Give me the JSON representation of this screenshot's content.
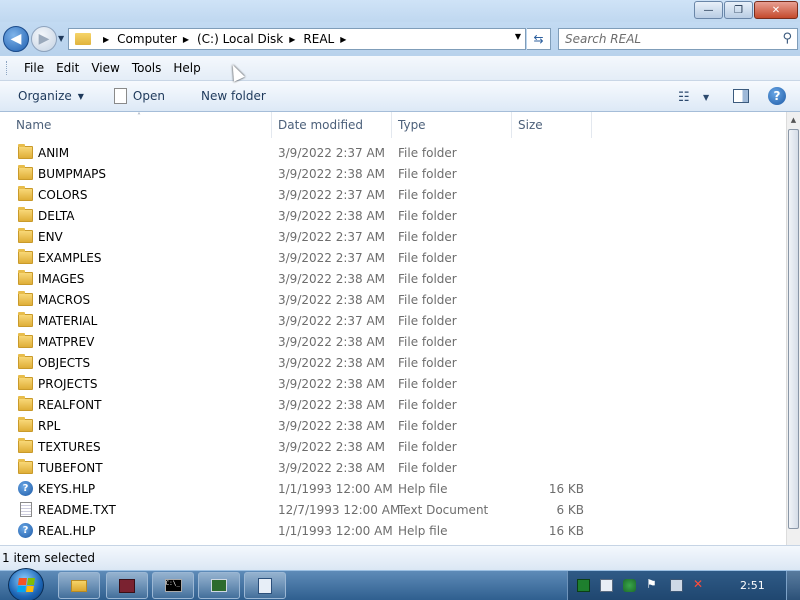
{
  "window": {
    "controls": {
      "minimize": "—",
      "maximize": "❐",
      "close": "✕"
    }
  },
  "address_bar": {
    "breadcrumbs": [
      "Computer",
      "(C:) Local Disk",
      "REAL"
    ],
    "search_placeholder": "Search REAL"
  },
  "menu": [
    "File",
    "Edit",
    "View",
    "Tools",
    "Help"
  ],
  "commands": {
    "organize": "Organize",
    "open": "Open",
    "new_folder": "New folder"
  },
  "columns": [
    "Name",
    "Date modified",
    "Type",
    "Size"
  ],
  "files": [
    {
      "icon": "folder-icon",
      "name": "ANIM",
      "date": "3/9/2022 2:37 AM",
      "type": "File folder",
      "size": ""
    },
    {
      "icon": "folder-icon",
      "name": "BUMPMAPS",
      "date": "3/9/2022 2:38 AM",
      "type": "File folder",
      "size": ""
    },
    {
      "icon": "folder-icon",
      "name": "COLORS",
      "date": "3/9/2022 2:37 AM",
      "type": "File folder",
      "size": ""
    },
    {
      "icon": "folder-icon",
      "name": "DELTA",
      "date": "3/9/2022 2:38 AM",
      "type": "File folder",
      "size": ""
    },
    {
      "icon": "folder-icon",
      "name": "ENV",
      "date": "3/9/2022 2:37 AM",
      "type": "File folder",
      "size": ""
    },
    {
      "icon": "folder-icon",
      "name": "EXAMPLES",
      "date": "3/9/2022 2:37 AM",
      "type": "File folder",
      "size": ""
    },
    {
      "icon": "folder-icon",
      "name": "IMAGES",
      "date": "3/9/2022 2:38 AM",
      "type": "File folder",
      "size": ""
    },
    {
      "icon": "folder-icon",
      "name": "MACROS",
      "date": "3/9/2022 2:38 AM",
      "type": "File folder",
      "size": ""
    },
    {
      "icon": "folder-icon",
      "name": "MATERIAL",
      "date": "3/9/2022 2:37 AM",
      "type": "File folder",
      "size": ""
    },
    {
      "icon": "folder-icon",
      "name": "MATPREV",
      "date": "3/9/2022 2:38 AM",
      "type": "File folder",
      "size": ""
    },
    {
      "icon": "folder-icon",
      "name": "OBJECTS",
      "date": "3/9/2022 2:38 AM",
      "type": "File folder",
      "size": ""
    },
    {
      "icon": "folder-icon",
      "name": "PROJECTS",
      "date": "3/9/2022 2:38 AM",
      "type": "File folder",
      "size": ""
    },
    {
      "icon": "folder-icon",
      "name": "REALFONT",
      "date": "3/9/2022 2:38 AM",
      "type": "File folder",
      "size": ""
    },
    {
      "icon": "folder-icon",
      "name": "RPL",
      "date": "3/9/2022 2:38 AM",
      "type": "File folder",
      "size": ""
    },
    {
      "icon": "folder-icon",
      "name": "TEXTURES",
      "date": "3/9/2022 2:38 AM",
      "type": "File folder",
      "size": ""
    },
    {
      "icon": "folder-icon",
      "name": "TUBEFONT",
      "date": "3/9/2022 2:38 AM",
      "type": "File folder",
      "size": ""
    },
    {
      "icon": "help-file-icon",
      "name": "KEYS.HLP",
      "date": "1/1/1993 12:00 AM",
      "type": "Help file",
      "size": "16 KB"
    },
    {
      "icon": "text-file-icon",
      "name": "README.TXT",
      "date": "12/7/1993 12:00 AM",
      "type": "Text Document",
      "size": "6 KB"
    },
    {
      "icon": "help-file-icon",
      "name": "REAL.HLP",
      "date": "1/1/1993 12:00 AM",
      "type": "Help file",
      "size": "16 KB"
    }
  ],
  "status_bar": {
    "text": "1 item selected"
  },
  "taskbar": {
    "clock": "2:51",
    "cmd_label": "C:\\_"
  }
}
